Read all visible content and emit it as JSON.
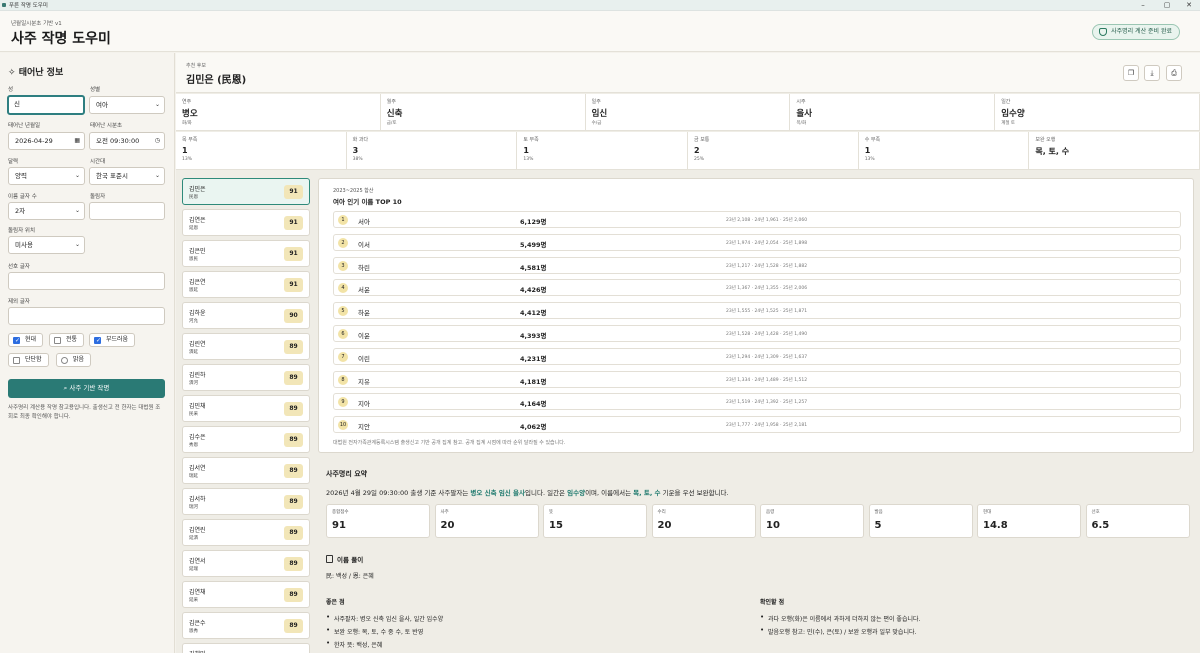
{
  "window": {
    "title": "푸른 작명 도우미",
    "minimize": "–",
    "maximize": "▢",
    "close": "✕"
  },
  "header": {
    "subtitle": "년월일시분초 기반 v1",
    "title": "사주 작명 도우미",
    "status_badge": "사주명리 계산 준비 완료"
  },
  "sidebar": {
    "title": "태어난 정보",
    "surname_label": "성",
    "surname_value": "신",
    "gender_label": "성별",
    "gender_value": "여아",
    "birth_date_label": "태어난 년월일",
    "birth_date_value": "2026-04-29",
    "birth_time_label": "태어난 시분초",
    "birth_time_value": "오전 09:30:00",
    "calendar_label": "달력",
    "calendar_value": "양력",
    "timezone_label": "시간대",
    "timezone_value": "한국 표준시",
    "name_length_label": "이름 글자 수",
    "name_length_value": "2자",
    "dolrimja_label": "돌림자",
    "dolrimja_value": "",
    "dolrimja_pos_label": "돌림자 위치",
    "dolrimja_pos_value": "미사용",
    "preferred_label": "선호 글자",
    "preferred_value": "",
    "excluded_label": "제외 글자",
    "excluded_value": "",
    "styles": [
      {
        "label": "현대",
        "checked": true
      },
      {
        "label": "전통",
        "checked": false
      },
      {
        "label": "부드러움",
        "checked": true
      },
      {
        "label": "단단함",
        "checked": false
      },
      {
        "label": "밝음",
        "checked": false
      }
    ],
    "submit_label": "사주 기반 작명",
    "note": "사주명리 계산용 작명 참고용입니다. 출생신고 전 한자는 대법원 조회로 최종 확인해야 합니다."
  },
  "result": {
    "small_label": "추천 후보",
    "name": "김민은 (民恩)",
    "actions": {
      "copy": "copy-icon",
      "download": "download-icon",
      "print": "print-icon"
    }
  },
  "pillars": [
    {
      "label": "연주",
      "value": "병오",
      "sub": "화/화"
    },
    {
      "label": "월주",
      "value": "신축",
      "sub": "금/토"
    },
    {
      "label": "일주",
      "value": "임신",
      "sub": "수/금"
    },
    {
      "label": "시주",
      "value": "을사",
      "sub": "목/화"
    },
    {
      "label": "일간",
      "value": "임수양",
      "sub": "계절 토"
    }
  ],
  "elements": [
    {
      "label": "목 부족",
      "value": "1",
      "pct": "13%"
    },
    {
      "label": "화 과다",
      "value": "3",
      "pct": "38%"
    },
    {
      "label": "토 부족",
      "value": "1",
      "pct": "13%"
    },
    {
      "label": "금 보통",
      "value": "2",
      "pct": "25%"
    },
    {
      "label": "수 부족",
      "value": "1",
      "pct": "13%"
    },
    {
      "label": "보완 오행",
      "value": "목, 토, 수",
      "pct": ""
    }
  ],
  "candidates": [
    {
      "name": "김민은",
      "hanja": "民恩",
      "score": "91"
    },
    {
      "name": "김연은",
      "hanja": "延恩",
      "score": "91"
    },
    {
      "name": "김은민",
      "hanja": "恩民",
      "score": "91"
    },
    {
      "name": "김은연",
      "hanja": "恩延",
      "score": "91"
    },
    {
      "name": "김하윤",
      "hanja": "河允",
      "score": "90"
    },
    {
      "name": "김린연",
      "hanja": "潾延",
      "score": "89"
    },
    {
      "name": "김린하",
      "hanja": "潾河",
      "score": "89"
    },
    {
      "name": "김민채",
      "hanja": "民采",
      "score": "89"
    },
    {
      "name": "김수은",
      "hanja": "秀恩",
      "score": "89"
    },
    {
      "name": "김서연",
      "hanja": "瑞延",
      "score": "89"
    },
    {
      "name": "김서하",
      "hanja": "瑞河",
      "score": "89"
    },
    {
      "name": "김연린",
      "hanja": "延潾",
      "score": "89"
    },
    {
      "name": "김연서",
      "hanja": "延瑞",
      "score": "89"
    },
    {
      "name": "김연채",
      "hanja": "延采",
      "score": "89"
    },
    {
      "name": "김은수",
      "hanja": "恩秀",
      "score": "89"
    },
    {
      "name": "김채민",
      "hanja": "",
      "score": ""
    }
  ],
  "ranking": {
    "subtitle": "2023~2025 합산",
    "title": "여아 인기 이름 TOP 10",
    "rows": [
      {
        "rank": "1",
        "name": "서아",
        "count": "6,129명",
        "detail": "23년 2,108 · 24년 1,961 · 25년 2,060"
      },
      {
        "rank": "2",
        "name": "이서",
        "count": "5,499명",
        "detail": "23년 1,974 · 24년 2,054 · 25년 1,898"
      },
      {
        "rank": "3",
        "name": "하린",
        "count": "4,581명",
        "detail": "23년 1,217 · 24년 1,528 · 25년 1,882"
      },
      {
        "rank": "4",
        "name": "서윤",
        "count": "4,426명",
        "detail": "23년 1,367 · 24년 1,355 · 25년 2,006"
      },
      {
        "rank": "5",
        "name": "하윤",
        "count": "4,412명",
        "detail": "23년 1,555 · 24년 1,525 · 25년 1,871"
      },
      {
        "rank": "6",
        "name": "이윤",
        "count": "4,393명",
        "detail": "23년 1,528 · 24년 1,428 · 25년 1,490"
      },
      {
        "rank": "7",
        "name": "이린",
        "count": "4,231명",
        "detail": "23년 1,294 · 24년 1,309 · 25년 1,637"
      },
      {
        "rank": "8",
        "name": "지유",
        "count": "4,181명",
        "detail": "23년 1,334 · 24년 1,489 · 25년 1,512"
      },
      {
        "rank": "9",
        "name": "지아",
        "count": "4,164명",
        "detail": "23년 1,519 · 24년 1,392 · 25년 1,257"
      },
      {
        "rank": "10",
        "name": "지안",
        "count": "4,062명",
        "detail": "23년 1,777 · 24년 1,958 · 25년 2,181"
      }
    ],
    "footnote": "대법원 전자가족관계등록시스템 출생신고 기반 공개 집계 참고. 공개 집계 시점에 따라 순위 달라질 수 있습니다."
  },
  "summary": {
    "title": "사주명리 요약",
    "line_a": "2026년 4월 29일 09:30:00 출생 기준 사주팔자는 ",
    "line_pillars": "병오 신축 임신 을사",
    "line_b": "입니다. 일간은 ",
    "line_daymaster": "임수양",
    "line_c": "이며, 이름에서는 ",
    "line_elements": "목, 토, 수",
    "line_d": " 기운을 우선 보완합니다."
  },
  "scores": [
    {
      "label": "종합점수",
      "value": "91"
    },
    {
      "label": "사주",
      "value": "20"
    },
    {
      "label": "뜻",
      "value": "15"
    },
    {
      "label": "수리",
      "value": "20"
    },
    {
      "label": "음령",
      "value": "10"
    },
    {
      "label": "발음",
      "value": "5"
    },
    {
      "label": "현대",
      "value": "14.8"
    },
    {
      "label": "선호",
      "value": "6.5"
    }
  ],
  "interpretation": {
    "title": "이름 풀이",
    "line": "民: 백성 / 恩: 은혜"
  },
  "strengths": {
    "title": "좋은 점",
    "items": [
      "사주팔자: 병오 신축 임신 을사, 일간 임수양",
      "보완 오행: 목, 토, 수 중 수, 토 반영",
      "한자 뜻: 백성, 은혜",
      "수리 길격 4/4"
    ]
  },
  "checks": {
    "title": "확인할 점",
    "items": [
      "과다 오행(화)은 이름에서 과하게 더하지 않는 편이 좋습니다.",
      "발음오행 참고: 민(수), 은(토) / 보완 오행과 일부 맞습니다."
    ]
  }
}
